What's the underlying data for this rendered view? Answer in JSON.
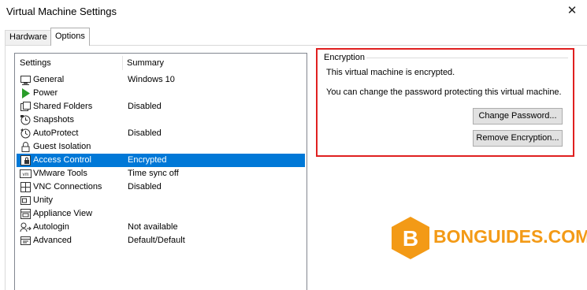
{
  "window": {
    "title": "Virtual Machine Settings",
    "close_glyph": "✕"
  },
  "tabs": [
    {
      "label": "Hardware",
      "active": false
    },
    {
      "label": "Options",
      "active": true
    }
  ],
  "list": {
    "col1": "Settings",
    "col2": "Summary",
    "items": [
      {
        "label": "General",
        "summary": "Windows 10",
        "icon": "general-icon"
      },
      {
        "label": "Power",
        "summary": "",
        "icon": "power-icon"
      },
      {
        "label": "Shared Folders",
        "summary": "Disabled",
        "icon": "shared-folders-icon"
      },
      {
        "label": "Snapshots",
        "summary": "",
        "icon": "snapshots-icon"
      },
      {
        "label": "AutoProtect",
        "summary": "Disabled",
        "icon": "autoprotect-icon"
      },
      {
        "label": "Guest Isolation",
        "summary": "",
        "icon": "lock-icon"
      },
      {
        "label": "Access Control",
        "summary": "Encrypted",
        "icon": "access-control-icon",
        "selected": true
      },
      {
        "label": "VMware Tools",
        "summary": "Time sync off",
        "icon": "vmware-tools-icon"
      },
      {
        "label": "VNC Connections",
        "summary": "Disabled",
        "icon": "vnc-icon"
      },
      {
        "label": "Unity",
        "summary": "",
        "icon": "unity-icon"
      },
      {
        "label": "Appliance View",
        "summary": "",
        "icon": "appliance-view-icon"
      },
      {
        "label": "Autologin",
        "summary": "Not available",
        "icon": "autologin-icon"
      },
      {
        "label": "Advanced",
        "summary": "Default/Default",
        "icon": "advanced-icon"
      }
    ]
  },
  "encryption": {
    "group_title": "Encryption",
    "message1": "This virtual machine is encrypted.",
    "message2": "You can change the password protecting this virtual machine.",
    "change_password_label": "Change Password...",
    "remove_encryption_label": "Remove Encryption..."
  },
  "watermark": {
    "text": "BONGUIDES.COM",
    "letter": "B"
  },
  "colors": {
    "selection": "#0078d7",
    "highlight_box": "#e02020",
    "watermark": "#f39a16"
  }
}
